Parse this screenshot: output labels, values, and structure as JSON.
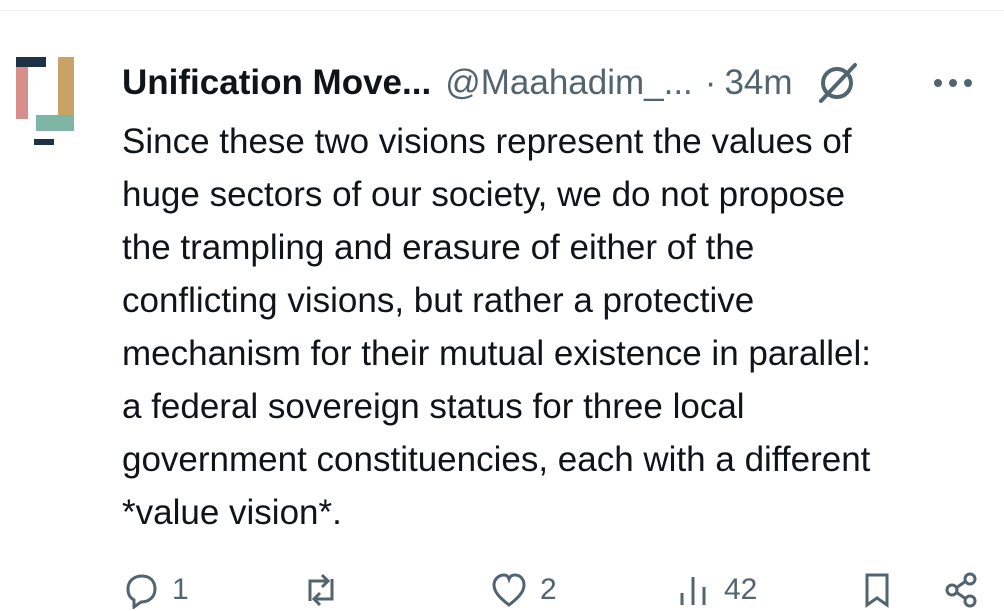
{
  "post": {
    "author_name": "Unification Move...",
    "author_handle": "@Maahadim_...",
    "separator": "·",
    "time": "34m",
    "text": "Since these two visions represent the values of\nhuge sectors of our society, we do not propose\nthe trampling and erasure of either of the\nconflicting visions, but rather a protective\nmechanism for their mutual existence in parallel:\na federal sovereign status for three local\ngovernment constituencies, each with a different\n*value vision*.",
    "icons": [
      "avatar-logo",
      "grok-icon",
      "more-icon"
    ]
  },
  "actions": {
    "reply_count": "1",
    "repost_count": "",
    "like_count": "2",
    "views_count": "42"
  },
  "colors": {
    "text": "#0f1419",
    "secondary": "#536471",
    "divider": "#eff3f4",
    "logo_navy": "#1d3247",
    "logo_pink": "#d88f8b",
    "logo_gold": "#c9a267",
    "logo_teal": "#7fb5a4"
  }
}
